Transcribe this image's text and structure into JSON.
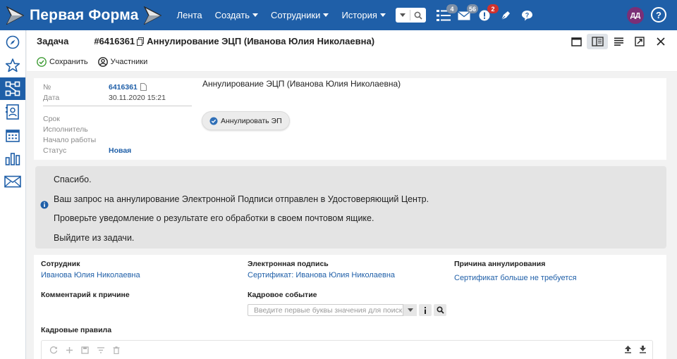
{
  "app": {
    "title": "Первая Форма",
    "nav": [
      {
        "label": "Лента",
        "dropdown": false
      },
      {
        "label": "Создать",
        "dropdown": true
      },
      {
        "label": "Сотрудники",
        "dropdown": true
      },
      {
        "label": "История",
        "dropdown": true
      }
    ],
    "badges": {
      "tasks": "4",
      "mail": "56",
      "alerts": "2"
    },
    "user_initials": "ДД",
    "help": "?"
  },
  "task": {
    "header_label": "Задача",
    "number": "#6416361",
    "title": "Аннулирование ЭЦП (Иванова Юлия Николаевна)",
    "toolbar": {
      "save": "Сохранить",
      "participants": "Участники"
    },
    "props": {
      "no_key": "№",
      "no_val": "6416361",
      "date_key": "Дата",
      "date_val": "30.11.2020 15:21",
      "deadline_key": "Срок",
      "executor_key": "Исполнитель",
      "start_key": "Начало работы",
      "status_key": "Статус",
      "status_val": "Новая"
    },
    "card_title": "Аннулирование ЭЦП (Иванова Юлия Николаевна)",
    "annul_button": "Аннулировать ЭП"
  },
  "message": {
    "line1": "Спасибо.",
    "line2": "Ваш запрос на аннулирование Электронной Подписи отправлен в Удостоверяющий Центр.",
    "line3": "Проверьте уведомление о результате его обработки в своем почтовом ящике.",
    "line4": "Выйдите из задачи."
  },
  "fields": {
    "employee_label": "Сотрудник",
    "employee_value": "Иванова Юлия Николаевна",
    "esign_label": "Электронная подпись",
    "esign_value": "Сертификат: Иванова Юлия Николаевна",
    "reason_label": "Причина аннулирования",
    "reason_value": "Сертификат больше не требуется",
    "comment_label": "Комментарий к причине",
    "hr_event_label": "Кадровое событие",
    "hr_event_placeholder": "Введите первые буквы значения для поиска",
    "hr_rules_label": "Кадровые правила"
  },
  "colors": {
    "brand": "#1f5fa8",
    "alert": "#d0312d",
    "avatar": "#7b2f76"
  }
}
